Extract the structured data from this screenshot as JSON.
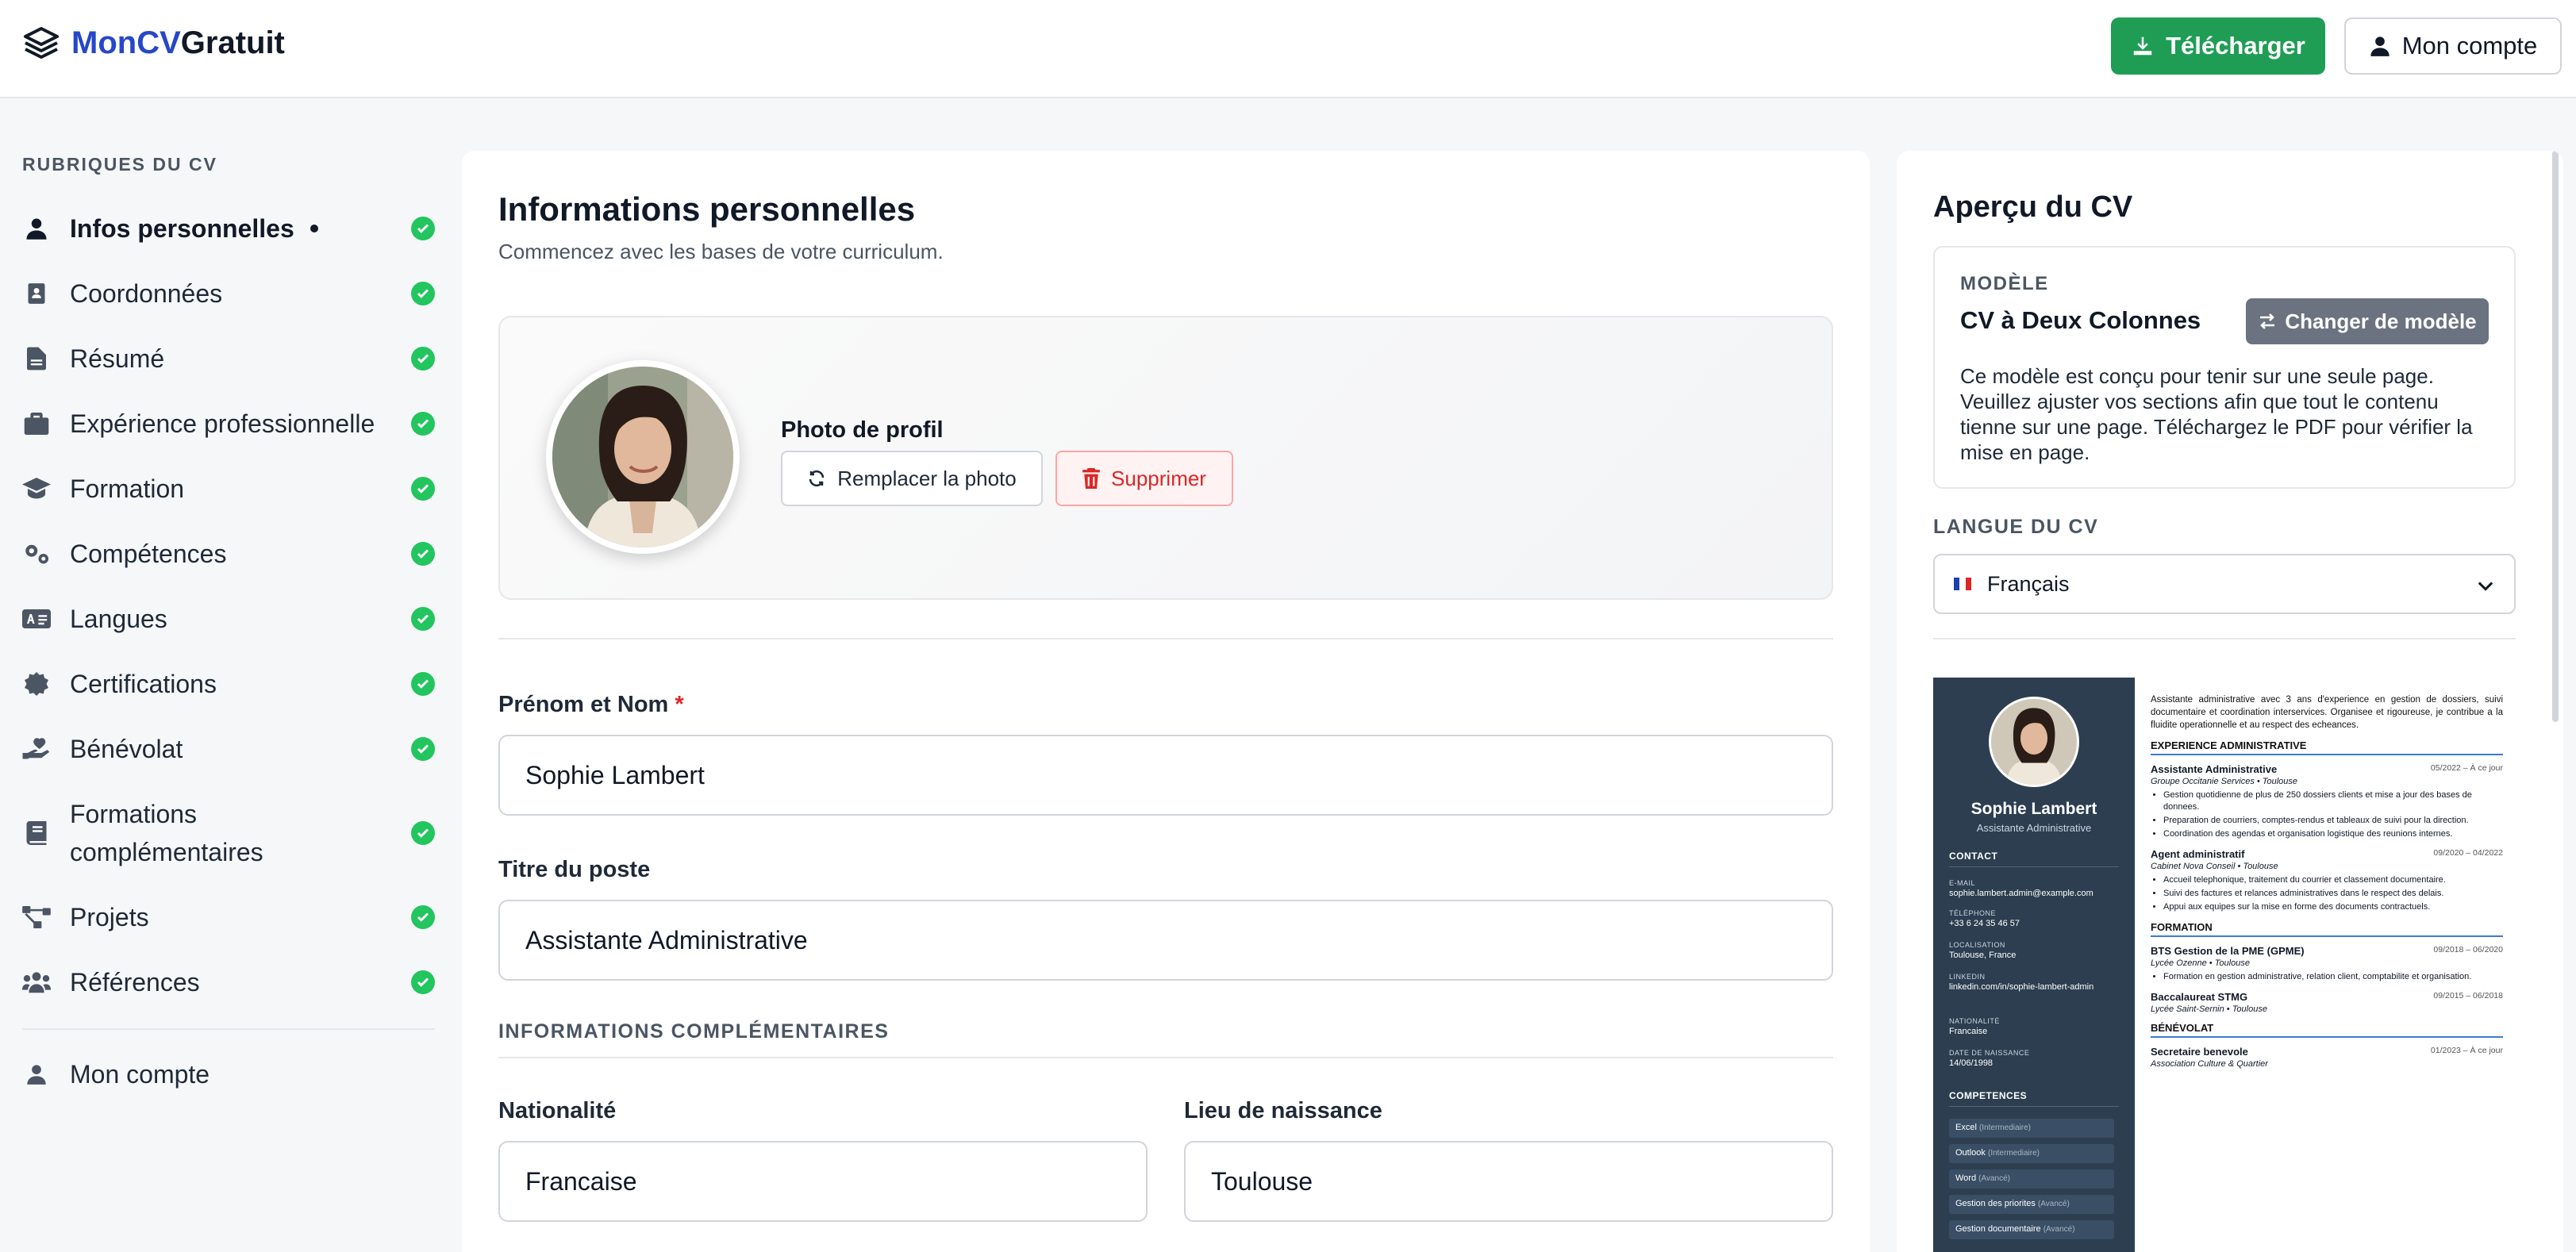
{
  "header": {
    "logo_a": "MonCV",
    "logo_b": "Gratuit",
    "download_label": "Télécharger",
    "account_label": "Mon compte"
  },
  "sidebar": {
    "title": "RUBRIQUES DU CV",
    "items": [
      {
        "label": "Infos personnelles",
        "icon": "user-icon",
        "active": true
      },
      {
        "label": "Coordonnées",
        "icon": "contact-book-icon"
      },
      {
        "label": "Résumé",
        "icon": "document-icon"
      },
      {
        "label": "Expérience professionnelle",
        "icon": "briefcase-icon"
      },
      {
        "label": "Formation",
        "icon": "graduation-cap-icon"
      },
      {
        "label": "Compétences",
        "icon": "gears-icon"
      },
      {
        "label": "Langues",
        "icon": "language-icon"
      },
      {
        "label": "Certifications",
        "icon": "certificate-icon"
      },
      {
        "label": "Bénévolat",
        "icon": "hand-heart-icon"
      },
      {
        "label": "Formations complémentaires",
        "icon": "book-icon"
      },
      {
        "label": "Projets",
        "icon": "project-diagram-icon"
      },
      {
        "label": "Références",
        "icon": "users-icon"
      }
    ],
    "account_label": "Mon compte"
  },
  "main": {
    "title": "Informations personnelles",
    "subtitle": "Commencez avec les bases de votre curriculum.",
    "photo_label": "Photo de profil",
    "replace_label": "Remplacer la photo",
    "delete_label": "Supprimer",
    "fullname_label": "Prénom et Nom",
    "fullname_value": "Sophie Lambert",
    "jobtitle_label": "Titre du poste",
    "jobtitle_value": "Assistante Administrative",
    "extra_caption": "INFORMATIONS COMPLÉMENTAIRES",
    "nationality_label": "Nationalité",
    "nationality_value": "Francaise",
    "birthplace_label": "Lieu de naissance",
    "birthplace_value": "Toulouse"
  },
  "preview": {
    "title": "Aperçu du CV",
    "model_caption": "MODÈLE",
    "model_name": "CV à Deux Colonnes",
    "change_label": "Changer de modèle",
    "model_desc": "Ce modèle est conçu pour tenir sur une seule page. Veuillez ajuster vos sections afin que tout le contenu tienne sur une page. Téléchargez le PDF pour vérifier la mise en page.",
    "lang_caption": "LANGUE DU CV",
    "lang_value": "Français"
  },
  "cv": {
    "name": "Sophie Lambert",
    "role": "Assistante Administrative",
    "contact_h": "CONTACT",
    "email_k": "E-MAIL",
    "email_v": "sophie.lambert.admin@example.com",
    "phone_k": "TÉLÉPHONE",
    "phone_v": "+33 6 24 35 46 57",
    "loc_k": "LOCALISATION",
    "loc_v": "Toulouse, France",
    "li_k": "LINKEDIN",
    "li_v": "linkedin.com/in/sophie-lambert-admin",
    "nat_k": "NATIONALITÉ",
    "nat_v": "Francaise",
    "birth_k": "DATE DE NAISSANCE",
    "birth_v": "14/06/1998",
    "skills_h": "COMPETENCES",
    "skills": [
      {
        "name": "Excel",
        "level": "(Intermediaire)"
      },
      {
        "name": "Outlook",
        "level": "(Intermediaire)"
      },
      {
        "name": "Word",
        "level": "(Avancé)"
      },
      {
        "name": "Gestion des priorites",
        "level": "(Avancé)"
      },
      {
        "name": "Gestion documentaire",
        "level": "(Avancé)"
      }
    ],
    "intro": "Assistante administrative avec 3 ans d'experience en gestion de dossiers, suivi documentaire et coordination interservices. Organisee et rigoureuse, je contribue a la fluidite operationnelle et au respect des echeances.",
    "exp_h": "EXPERIENCE ADMINISTRATIVE",
    "job1": {
      "title": "Assistante Administrative",
      "dates": "05/2022 – À ce jour",
      "org": "Groupe Occitanie Services • Toulouse",
      "b1": "Gestion quotidienne de plus de 250 dossiers clients et mise a jour des bases de donnees.",
      "b2": "Preparation de courriers, comptes-rendus et tableaux de suivi pour la direction.",
      "b3": "Coordination des agendas et organisation logistique des reunions internes."
    },
    "job2": {
      "title": "Agent administratif",
      "dates": "09/2020 – 04/2022",
      "org": "Cabinet Nova Conseil • Toulouse",
      "b1": "Accueil telephonique, traitement du courrier et classement documentaire.",
      "b2": "Suivi des factures et relances administratives dans le respect des delais.",
      "b3": "Appui aux equipes sur la mise en forme des documents contractuels."
    },
    "edu_h": "FORMATION",
    "edu1": {
      "title": "BTS Gestion de la PME (GPME)",
      "dates": "09/2018 – 06/2020",
      "org": "Lycée Ozenne • Toulouse",
      "b1": "Formation en gestion administrative, relation client, comptabilite et organisation."
    },
    "edu2": {
      "title": "Baccalaureat STMG",
      "dates": "09/2015 – 06/2018",
      "org": "Lycée Saint-Sernin • Toulouse"
    },
    "vol_h": "BÉNÉVOLAT",
    "vol1": {
      "title": "Secretaire benevole",
      "dates": "01/2023 – À ce jour",
      "org": "Association Culture & Quartier"
    }
  }
}
